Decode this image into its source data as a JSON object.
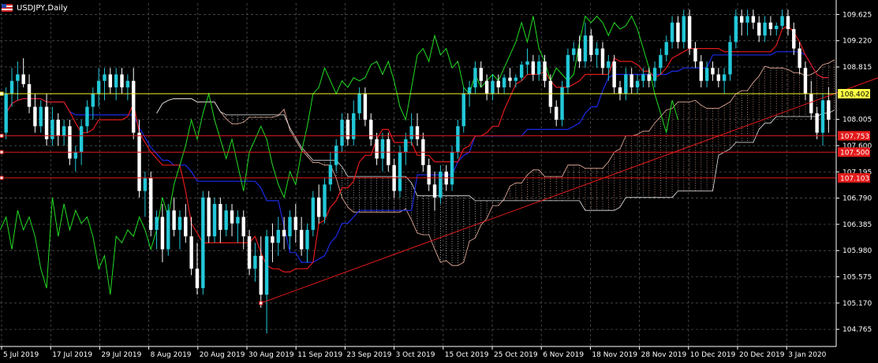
{
  "title": "USDJPY,Daily",
  "colors": {
    "background": "#000000",
    "grid": "#5a5a5a",
    "bull_candle": "#22c8d8",
    "bear_candle": "#ffffff",
    "tenkan": "#e31a1a",
    "kijun": "#1a2ae8",
    "chikou": "#22dd22",
    "senkou_a": "#f0b4a0",
    "senkou_b": "#e8e8e8",
    "trendline": "#e31a1a",
    "highlight_line": "#f0f030",
    "level_lines": "#e31a1a",
    "axis_text": "#ffffff"
  },
  "chart_data": {
    "type": "candlestick",
    "symbol": "USDJPY",
    "timeframe": "Daily",
    "ylim": [
      104.5,
      109.8
    ],
    "y_ticks": [
      "109.625",
      "109.220",
      "108.815",
      "108.005",
      "107.600",
      "107.195",
      "106.790",
      "106.385",
      "105.980",
      "105.575",
      "105.170",
      "104.765"
    ],
    "x_ticks": [
      "5 Jul 2019",
      "17 Jul 2019",
      "29 Jul 2019",
      "8 Aug 2019",
      "20 Aug 2019",
      "30 Aug 2019",
      "11 Sep 2019",
      "23 Sep 2019",
      "3 Oct 2019",
      "15 Oct 2019",
      "25 Oct 2019",
      "6 Nov 2019",
      "18 Nov 2019",
      "28 Nov 2019",
      "10 Dec 2019",
      "20 Dec 2019",
      "3 Jan 2020"
    ],
    "price_labels": [
      {
        "text": "108.402",
        "value": 108.402,
        "style": "yellow"
      },
      {
        "text": "107.753",
        "value": 107.753,
        "style": "red"
      },
      {
        "text": "107.500",
        "value": 107.5,
        "style": "red"
      },
      {
        "text": "107.103",
        "value": 107.103,
        "style": "red"
      }
    ],
    "horizontal_lines": [
      {
        "value": 108.402,
        "color": "yellow"
      },
      {
        "value": 107.753,
        "color": "red"
      },
      {
        "value": 107.5,
        "color": "red"
      },
      {
        "value": 107.103,
        "color": "red"
      }
    ],
    "trendline": {
      "from": {
        "bar": 44,
        "value": 105.17
      },
      "to": {
        "bar": 165,
        "value": 109.12
      }
    },
    "candles": [
      {
        "o": 107.8,
        "h": 108.5,
        "l": 107.7,
        "c": 108.4
      },
      {
        "o": 108.4,
        "h": 108.8,
        "l": 108.2,
        "c": 108.6
      },
      {
        "o": 108.6,
        "h": 108.9,
        "l": 108.3,
        "c": 108.7
      },
      {
        "o": 108.7,
        "h": 108.95,
        "l": 108.5,
        "c": 108.55
      },
      {
        "o": 108.55,
        "h": 108.7,
        "l": 108.1,
        "c": 108.2
      },
      {
        "o": 108.2,
        "h": 108.4,
        "l": 107.8,
        "c": 107.9
      },
      {
        "o": 107.9,
        "h": 108.3,
        "l": 107.8,
        "c": 108.2
      },
      {
        "o": 108.2,
        "h": 108.4,
        "l": 107.6,
        "c": 107.7
      },
      {
        "o": 107.7,
        "h": 108.2,
        "l": 107.6,
        "c": 108.0
      },
      {
        "o": 108.0,
        "h": 108.1,
        "l": 107.6,
        "c": 107.75
      },
      {
        "o": 107.75,
        "h": 108.0,
        "l": 107.6,
        "c": 107.9
      },
      {
        "o": 107.9,
        "h": 108.0,
        "l": 107.3,
        "c": 107.4
      },
      {
        "o": 107.4,
        "h": 107.6,
        "l": 107.2,
        "c": 107.5
      },
      {
        "o": 107.5,
        "h": 108.0,
        "l": 107.3,
        "c": 107.9
      },
      {
        "o": 107.9,
        "h": 108.3,
        "l": 107.8,
        "c": 108.2
      },
      {
        "o": 108.2,
        "h": 108.5,
        "l": 108.0,
        "c": 108.4
      },
      {
        "o": 108.4,
        "h": 108.8,
        "l": 108.2,
        "c": 108.6
      },
      {
        "o": 108.6,
        "h": 108.8,
        "l": 108.3,
        "c": 108.7
      },
      {
        "o": 108.7,
        "h": 108.8,
        "l": 108.4,
        "c": 108.5
      },
      {
        "o": 108.5,
        "h": 108.8,
        "l": 108.3,
        "c": 108.7
      },
      {
        "o": 108.7,
        "h": 108.8,
        "l": 108.4,
        "c": 108.5
      },
      {
        "o": 108.5,
        "h": 108.7,
        "l": 108.3,
        "c": 108.6
      },
      {
        "o": 108.6,
        "h": 108.8,
        "l": 107.7,
        "c": 107.8
      },
      {
        "o": 107.8,
        "h": 108.0,
        "l": 106.8,
        "c": 106.9
      },
      {
        "o": 106.9,
        "h": 107.2,
        "l": 106.5,
        "c": 107.1
      },
      {
        "o": 107.1,
        "h": 107.2,
        "l": 106.2,
        "c": 106.3
      },
      {
        "o": 106.3,
        "h": 106.6,
        "l": 106.0,
        "c": 106.5
      },
      {
        "o": 106.5,
        "h": 106.7,
        "l": 105.8,
        "c": 106.0
      },
      {
        "o": 106.0,
        "h": 106.7,
        "l": 105.9,
        "c": 106.6
      },
      {
        "o": 106.6,
        "h": 106.8,
        "l": 106.2,
        "c": 106.3
      },
      {
        "o": 106.3,
        "h": 106.6,
        "l": 106.0,
        "c": 106.5
      },
      {
        "o": 106.5,
        "h": 106.7,
        "l": 106.1,
        "c": 106.2
      },
      {
        "o": 106.2,
        "h": 106.5,
        "l": 105.6,
        "c": 105.7
      },
      {
        "o": 105.7,
        "h": 106.1,
        "l": 105.3,
        "c": 105.4
      },
      {
        "o": 105.4,
        "h": 106.9,
        "l": 105.3,
        "c": 106.8
      },
      {
        "o": 106.8,
        "h": 106.9,
        "l": 106.1,
        "c": 106.2
      },
      {
        "o": 106.2,
        "h": 106.8,
        "l": 106.1,
        "c": 106.7
      },
      {
        "o": 106.7,
        "h": 106.8,
        "l": 106.1,
        "c": 106.3
      },
      {
        "o": 106.3,
        "h": 106.7,
        "l": 106.2,
        "c": 106.6
      },
      {
        "o": 106.6,
        "h": 106.7,
        "l": 106.2,
        "c": 106.4
      },
      {
        "o": 106.4,
        "h": 106.6,
        "l": 106.1,
        "c": 106.5
      },
      {
        "o": 106.5,
        "h": 106.6,
        "l": 106.0,
        "c": 106.2
      },
      {
        "o": 106.2,
        "h": 106.3,
        "l": 105.6,
        "c": 105.7
      },
      {
        "o": 105.7,
        "h": 106.1,
        "l": 105.5,
        "c": 105.9
      },
      {
        "o": 105.9,
        "h": 106.2,
        "l": 105.1,
        "c": 105.3
      },
      {
        "o": 105.3,
        "h": 106.3,
        "l": 104.7,
        "c": 106.2
      },
      {
        "o": 106.2,
        "h": 106.4,
        "l": 105.8,
        "c": 106.1
      },
      {
        "o": 106.1,
        "h": 106.5,
        "l": 105.9,
        "c": 106.3
      },
      {
        "o": 106.3,
        "h": 106.5,
        "l": 106.0,
        "c": 106.2
      },
      {
        "o": 106.2,
        "h": 106.6,
        "l": 106.0,
        "c": 106.5
      },
      {
        "o": 106.5,
        "h": 106.7,
        "l": 106.1,
        "c": 106.3
      },
      {
        "o": 106.3,
        "h": 106.5,
        "l": 105.9,
        "c": 106.0
      },
      {
        "o": 106.0,
        "h": 106.4,
        "l": 105.8,
        "c": 106.3
      },
      {
        "o": 106.3,
        "h": 106.9,
        "l": 106.2,
        "c": 106.8
      },
      {
        "o": 106.8,
        "h": 107.0,
        "l": 106.4,
        "c": 106.5
      },
      {
        "o": 106.5,
        "h": 107.1,
        "l": 106.4,
        "c": 107.0
      },
      {
        "o": 107.0,
        "h": 107.5,
        "l": 106.9,
        "c": 107.3
      },
      {
        "o": 107.3,
        "h": 107.7,
        "l": 107.2,
        "c": 107.6
      },
      {
        "o": 107.6,
        "h": 108.1,
        "l": 107.5,
        "c": 108.0
      },
      {
        "o": 108.0,
        "h": 108.1,
        "l": 107.6,
        "c": 107.7
      },
      {
        "o": 107.7,
        "h": 108.3,
        "l": 107.6,
        "c": 108.1
      },
      {
        "o": 108.1,
        "h": 108.5,
        "l": 108.0,
        "c": 108.4
      },
      {
        "o": 108.4,
        "h": 108.5,
        "l": 107.9,
        "c": 108.0
      },
      {
        "o": 108.0,
        "h": 108.1,
        "l": 107.6,
        "c": 107.7
      },
      {
        "o": 107.7,
        "h": 107.8,
        "l": 107.3,
        "c": 107.4
      },
      {
        "o": 107.4,
        "h": 107.8,
        "l": 107.2,
        "c": 107.7
      },
      {
        "o": 107.7,
        "h": 107.8,
        "l": 107.2,
        "c": 107.3
      },
      {
        "o": 107.3,
        "h": 107.4,
        "l": 106.8,
        "c": 106.9
      },
      {
        "o": 106.9,
        "h": 107.6,
        "l": 106.8,
        "c": 107.5
      },
      {
        "o": 107.5,
        "h": 107.8,
        "l": 107.3,
        "c": 107.7
      },
      {
        "o": 107.7,
        "h": 108.1,
        "l": 107.6,
        "c": 107.9
      },
      {
        "o": 107.9,
        "h": 108.1,
        "l": 107.6,
        "c": 107.7
      },
      {
        "o": 107.7,
        "h": 107.8,
        "l": 107.2,
        "c": 107.3
      },
      {
        "o": 107.3,
        "h": 107.4,
        "l": 106.9,
        "c": 107.0
      },
      {
        "o": 107.0,
        "h": 107.2,
        "l": 106.6,
        "c": 106.8
      },
      {
        "o": 106.8,
        "h": 107.3,
        "l": 106.7,
        "c": 107.2
      },
      {
        "o": 107.2,
        "h": 107.3,
        "l": 106.9,
        "c": 107.0
      },
      {
        "o": 107.0,
        "h": 107.6,
        "l": 106.9,
        "c": 107.5
      },
      {
        "o": 107.5,
        "h": 108.0,
        "l": 107.4,
        "c": 107.9
      },
      {
        "o": 107.9,
        "h": 108.5,
        "l": 107.8,
        "c": 108.4
      },
      {
        "o": 108.4,
        "h": 108.6,
        "l": 108.2,
        "c": 108.5
      },
      {
        "o": 108.5,
        "h": 108.9,
        "l": 108.4,
        "c": 108.8
      },
      {
        "o": 108.8,
        "h": 108.9,
        "l": 108.5,
        "c": 108.6
      },
      {
        "o": 108.6,
        "h": 108.7,
        "l": 108.3,
        "c": 108.4
      },
      {
        "o": 108.4,
        "h": 108.7,
        "l": 108.3,
        "c": 108.6
      },
      {
        "o": 108.6,
        "h": 108.7,
        "l": 108.4,
        "c": 108.5
      },
      {
        "o": 108.5,
        "h": 108.7,
        "l": 108.4,
        "c": 108.65
      },
      {
        "o": 108.65,
        "h": 108.8,
        "l": 108.5,
        "c": 108.6
      },
      {
        "o": 108.6,
        "h": 108.7,
        "l": 108.5,
        "c": 108.65
      },
      {
        "o": 108.65,
        "h": 108.9,
        "l": 108.6,
        "c": 108.85
      },
      {
        "o": 108.85,
        "h": 109.1,
        "l": 108.7,
        "c": 108.9
      },
      {
        "o": 108.9,
        "h": 109.0,
        "l": 108.6,
        "c": 108.7
      },
      {
        "o": 108.7,
        "h": 109.0,
        "l": 108.6,
        "c": 108.9
      },
      {
        "o": 108.9,
        "h": 109.0,
        "l": 108.5,
        "c": 108.6
      },
      {
        "o": 108.6,
        "h": 108.7,
        "l": 108.1,
        "c": 108.2
      },
      {
        "o": 108.2,
        "h": 108.3,
        "l": 107.9,
        "c": 108.0
      },
      {
        "o": 108.0,
        "h": 108.6,
        "l": 107.9,
        "c": 108.5
      },
      {
        "o": 108.5,
        "h": 109.1,
        "l": 108.4,
        "c": 109.0
      },
      {
        "o": 109.0,
        "h": 109.2,
        "l": 108.9,
        "c": 109.1
      },
      {
        "o": 109.1,
        "h": 109.3,
        "l": 108.8,
        "c": 108.9
      },
      {
        "o": 108.9,
        "h": 109.5,
        "l": 108.8,
        "c": 109.3
      },
      {
        "o": 109.3,
        "h": 109.4,
        "l": 108.9,
        "c": 109.0
      },
      {
        "o": 109.0,
        "h": 109.2,
        "l": 108.8,
        "c": 109.1
      },
      {
        "o": 109.1,
        "h": 109.2,
        "l": 108.7,
        "c": 108.8
      },
      {
        "o": 108.8,
        "h": 109.0,
        "l": 108.6,
        "c": 108.9
      },
      {
        "o": 108.9,
        "h": 109.0,
        "l": 108.4,
        "c": 108.5
      },
      {
        "o": 108.5,
        "h": 108.6,
        "l": 108.3,
        "c": 108.4
      },
      {
        "o": 108.4,
        "h": 108.8,
        "l": 108.3,
        "c": 108.7
      },
      {
        "o": 108.7,
        "h": 108.8,
        "l": 108.4,
        "c": 108.5
      },
      {
        "o": 108.5,
        "h": 108.7,
        "l": 108.4,
        "c": 108.6
      },
      {
        "o": 108.6,
        "h": 108.8,
        "l": 108.5,
        "c": 108.7
      },
      {
        "o": 108.7,
        "h": 108.8,
        "l": 108.5,
        "c": 108.6
      },
      {
        "o": 108.6,
        "h": 108.9,
        "l": 108.5,
        "c": 108.8
      },
      {
        "o": 108.8,
        "h": 109.1,
        "l": 108.7,
        "c": 109.0
      },
      {
        "o": 109.0,
        "h": 109.3,
        "l": 108.9,
        "c": 109.2
      },
      {
        "o": 109.2,
        "h": 109.6,
        "l": 109.1,
        "c": 109.5
      },
      {
        "o": 109.5,
        "h": 109.6,
        "l": 109.1,
        "c": 109.2
      },
      {
        "o": 109.2,
        "h": 109.7,
        "l": 109.1,
        "c": 109.6
      },
      {
        "o": 109.6,
        "h": 109.7,
        "l": 109.0,
        "c": 109.1
      },
      {
        "o": 109.1,
        "h": 109.2,
        "l": 108.8,
        "c": 108.9
      },
      {
        "o": 108.9,
        "h": 109.0,
        "l": 108.5,
        "c": 108.6
      },
      {
        "o": 108.6,
        "h": 108.9,
        "l": 108.5,
        "c": 108.8
      },
      {
        "o": 108.8,
        "h": 108.9,
        "l": 108.6,
        "c": 108.7
      },
      {
        "o": 108.7,
        "h": 108.8,
        "l": 108.5,
        "c": 108.6
      },
      {
        "o": 108.6,
        "h": 108.8,
        "l": 108.4,
        "c": 108.7
      },
      {
        "o": 108.7,
        "h": 109.3,
        "l": 108.6,
        "c": 109.2
      },
      {
        "o": 109.2,
        "h": 109.7,
        "l": 109.1,
        "c": 109.6
      },
      {
        "o": 109.6,
        "h": 109.7,
        "l": 109.3,
        "c": 109.5
      },
      {
        "o": 109.5,
        "h": 109.7,
        "l": 109.3,
        "c": 109.6
      },
      {
        "o": 109.6,
        "h": 109.7,
        "l": 109.4,
        "c": 109.5
      },
      {
        "o": 109.5,
        "h": 109.6,
        "l": 109.2,
        "c": 109.3
      },
      {
        "o": 109.3,
        "h": 109.6,
        "l": 109.2,
        "c": 109.5
      },
      {
        "o": 109.5,
        "h": 109.6,
        "l": 109.3,
        "c": 109.4
      },
      {
        "o": 109.4,
        "h": 109.5,
        "l": 109.3,
        "c": 109.45
      },
      {
        "o": 109.45,
        "h": 109.7,
        "l": 109.4,
        "c": 109.6
      },
      {
        "o": 109.6,
        "h": 109.7,
        "l": 109.3,
        "c": 109.4
      },
      {
        "o": 109.4,
        "h": 109.5,
        "l": 109.0,
        "c": 109.1
      },
      {
        "o": 109.1,
        "h": 109.2,
        "l": 108.7,
        "c": 108.8
      },
      {
        "o": 108.8,
        "h": 108.9,
        "l": 108.3,
        "c": 108.4
      },
      {
        "o": 108.4,
        "h": 108.6,
        "l": 108.0,
        "c": 108.1
      },
      {
        "o": 108.1,
        "h": 108.2,
        "l": 107.7,
        "c": 107.8
      },
      {
        "o": 107.8,
        "h": 108.4,
        "l": 107.6,
        "c": 108.3
      },
      {
        "o": 108.3,
        "h": 108.5,
        "l": 107.8,
        "c": 108.0
      }
    ]
  }
}
